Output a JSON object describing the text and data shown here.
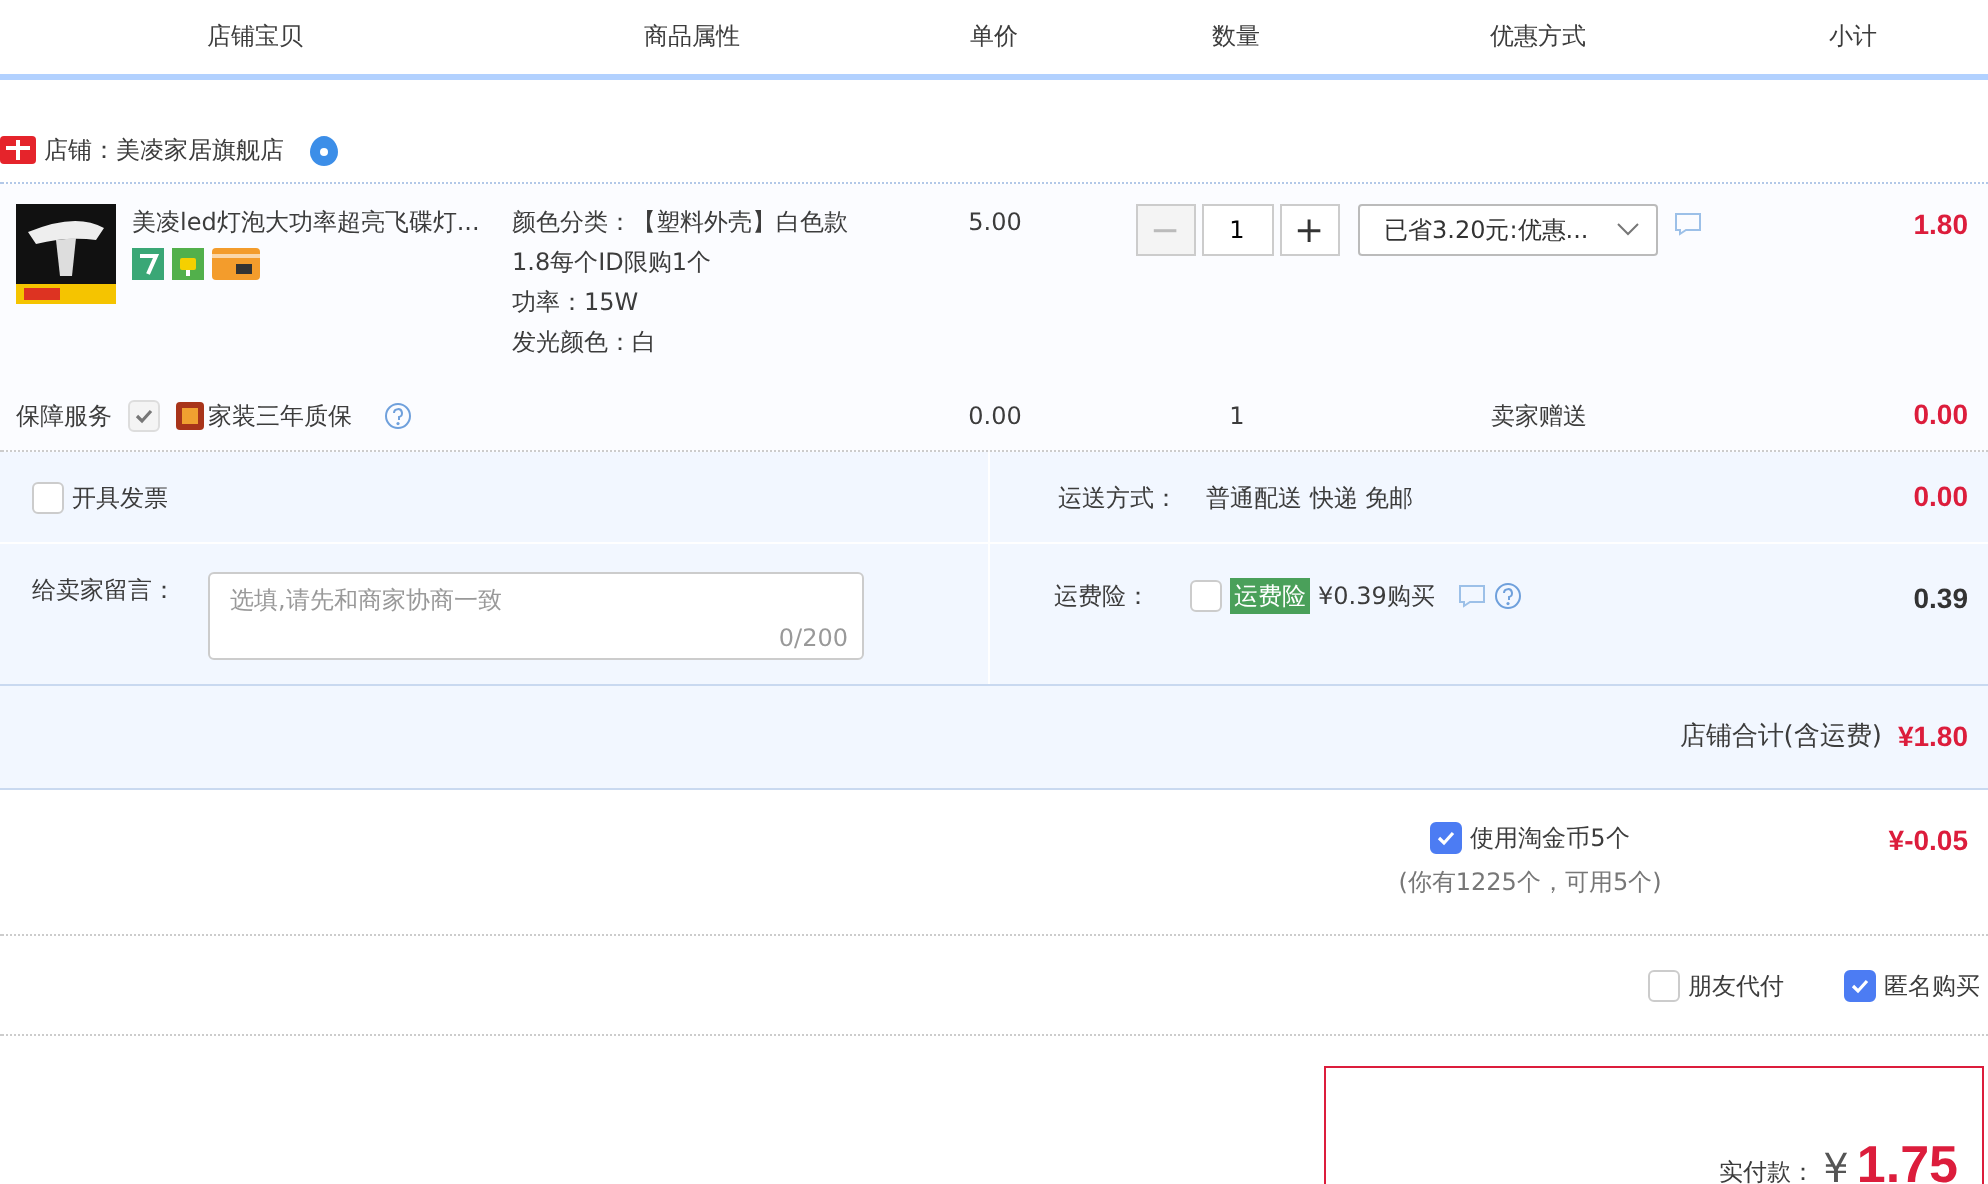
{
  "columns": [
    "店铺宝贝",
    "商品属性",
    "单价",
    "数量",
    "优惠方式",
    "小计"
  ],
  "shop": {
    "label": "店铺：美凌家居旗舰店"
  },
  "item": {
    "title": "美凌led灯泡大功率超亮飞碟灯...",
    "attributes": [
      "颜色分类：【塑料外壳】白色款",
      "1.8每个ID限购1个",
      "功率：15W",
      "发光颜色：白"
    ],
    "price": "5.00",
    "minus": "−",
    "quantity": "1",
    "plus": "+",
    "discount": "已省3.20元:优惠...",
    "subtotal": "1.80"
  },
  "service": {
    "label": "保障服务",
    "checked": true,
    "disabled": true,
    "name": "家装三年质保",
    "price": "0.00",
    "quantity": "1",
    "discount": "卖家赠送",
    "subtotal": "0.00"
  },
  "invoice": {
    "label": "开具发票",
    "checked": false
  },
  "shipping": {
    "label": "运送方式：",
    "method": "普通配送 快递 免邮",
    "amount": "0.00"
  },
  "message": {
    "label": "给卖家留言：",
    "placeholder": "选填,请先和商家协商一致",
    "counter": "0/200"
  },
  "insurance": {
    "label": "运费险：",
    "checked": false,
    "tag": "运费险",
    "offer": "¥0.39购买",
    "amount": "0.39"
  },
  "shop_total": {
    "label": "店铺合计(含运费)",
    "amount": "¥1.80"
  },
  "coins": {
    "label": "使用淘金币5个",
    "checked": true,
    "amount": "¥-0.05",
    "note": "(你有1225个，可用5个)"
  },
  "options": [
    {
      "label": "朋友代付",
      "checked": false
    },
    {
      "label": "匿名购买",
      "checked": true
    }
  ],
  "payment": {
    "label": "实付款：",
    "currency": "¥",
    "amount": "1.75"
  }
}
